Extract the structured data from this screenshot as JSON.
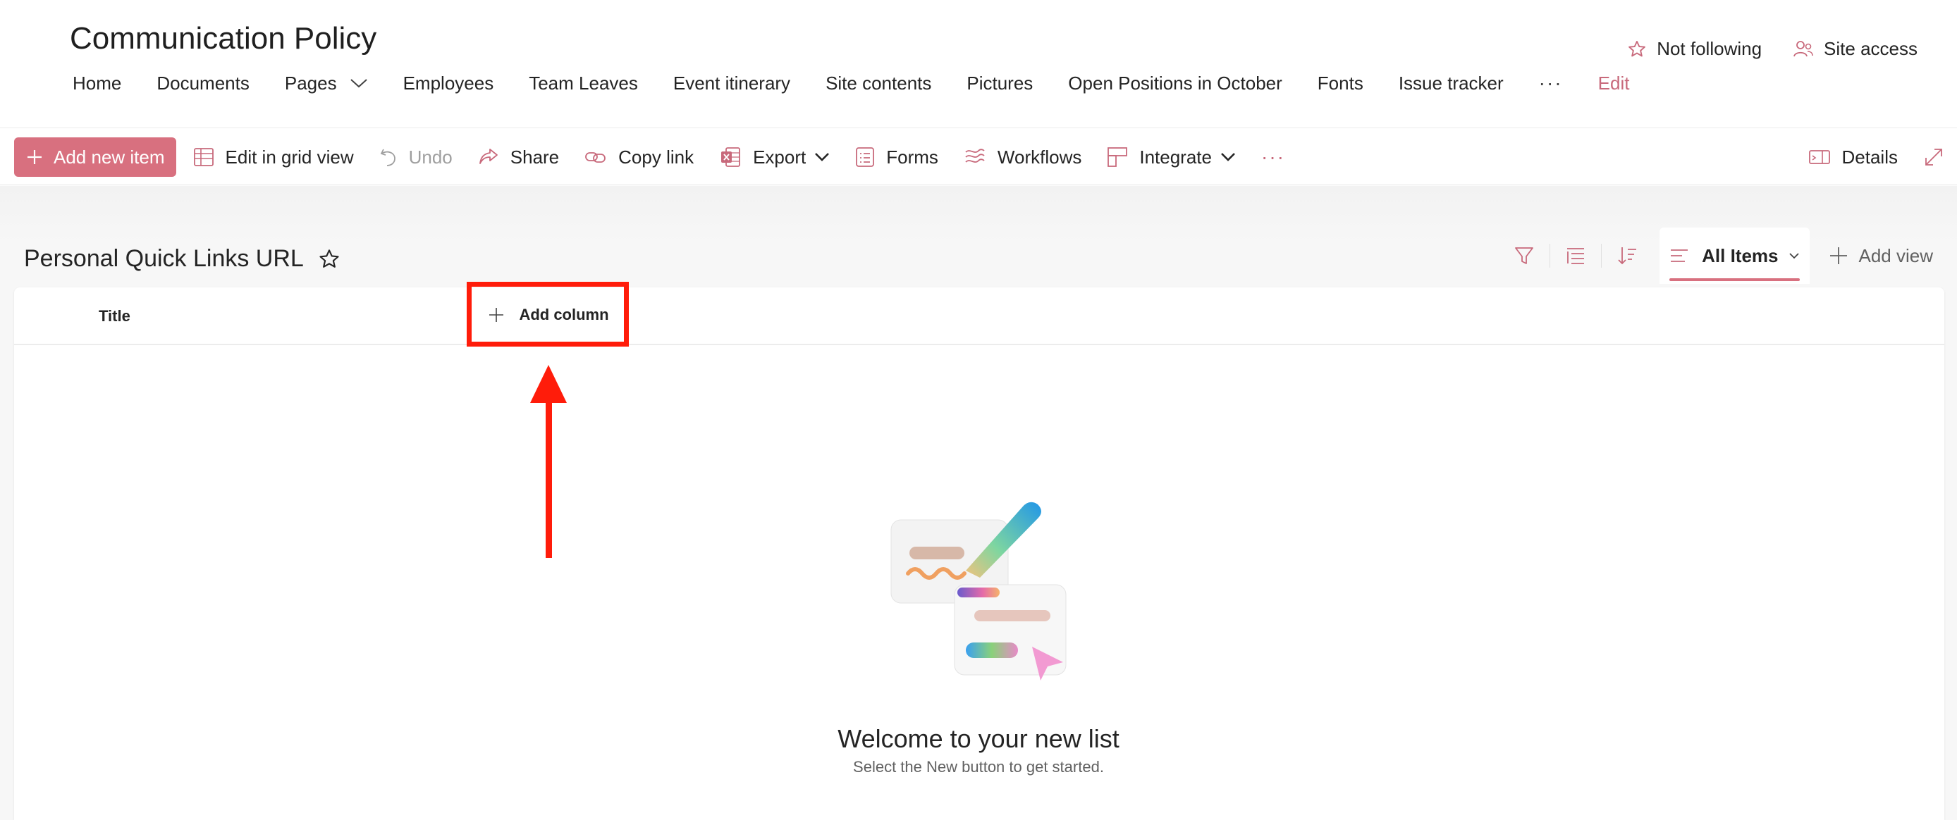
{
  "site": {
    "title": "Communication Policy",
    "nav": [
      {
        "label": "Home"
      },
      {
        "label": "Documents"
      },
      {
        "label": "Pages"
      },
      {
        "label": "Employees"
      },
      {
        "label": "Team Leaves"
      },
      {
        "label": "Event itinerary"
      },
      {
        "label": "Site contents"
      },
      {
        "label": "Pictures"
      },
      {
        "label": "Open Positions in October"
      },
      {
        "label": "Fonts"
      },
      {
        "label": "Issue tracker"
      }
    ],
    "nav_more": "···",
    "nav_edit": "Edit",
    "follow_label": "Not following",
    "access_label": "Site access"
  },
  "commandbar": {
    "add_new_item": "Add new item",
    "edit_grid": "Edit in grid view",
    "undo": "Undo",
    "share": "Share",
    "copy_link": "Copy link",
    "export": "Export",
    "forms": "Forms",
    "workflows": "Workflows",
    "integrate": "Integrate",
    "more": "···",
    "details": "Details"
  },
  "list": {
    "title": "Personal Quick Links URL",
    "view_name": "All Items",
    "add_view": "Add view",
    "columns": [
      "Title"
    ],
    "add_column": "Add column",
    "empty_title": "Welcome to your new list",
    "empty_subtitle": "Select the New button to get started."
  },
  "colors": {
    "accent": "#d8707f",
    "annotation": "#ff1c0a"
  }
}
